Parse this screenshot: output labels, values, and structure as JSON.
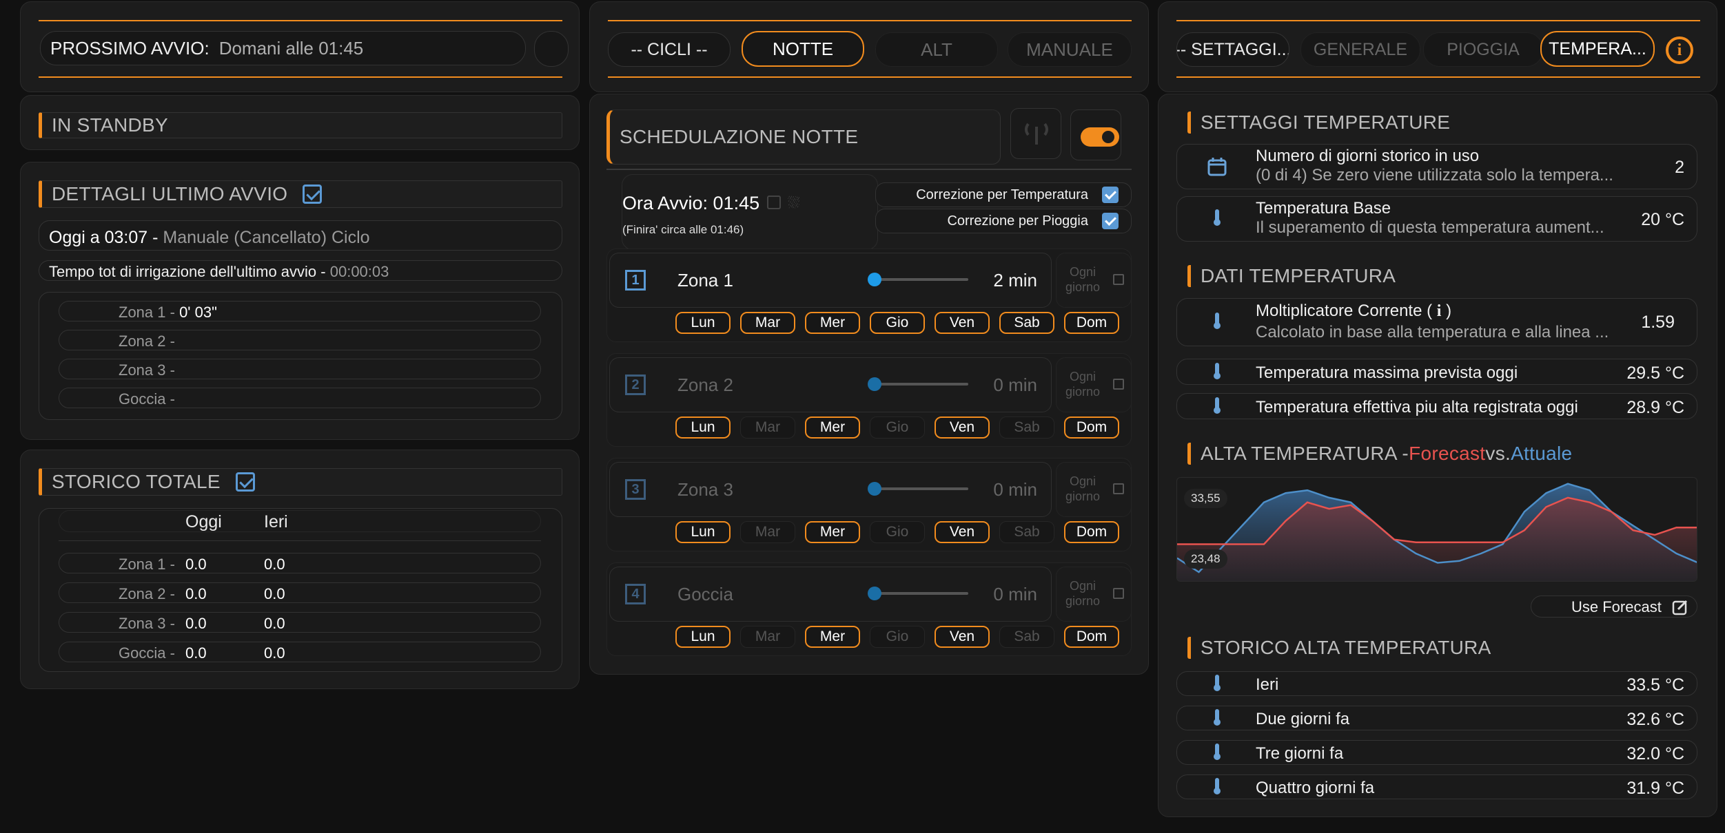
{
  "left": {
    "next_start_label": "PROSSIMO AVVIO:",
    "next_start_value": "Domani alle 01:45",
    "standby": "IN STANDBY",
    "last_details_title": "DETTAGLI ULTIMO AVVIO",
    "last_when": "Oggi a 03:07 -",
    "last_what": "Manuale (Cancellato) Ciclo",
    "total_time_label": "Tempo tot di irrigazione dell'ultimo avvio -",
    "total_time_value": "00:00:03",
    "zones": [
      {
        "label": "Zona 1 -",
        "value": "0' 03\""
      },
      {
        "label": "Zona 2 -",
        "value": ""
      },
      {
        "label": "Zona 3 -",
        "value": ""
      },
      {
        "label": "Goccia -",
        "value": ""
      }
    ],
    "history_title": "STORICO TOTALE",
    "history_col_today": "Oggi",
    "history_col_yesterday": "Ieri",
    "history": [
      {
        "label": "Zona 1 -",
        "today": "0.0",
        "yesterday": "0.0"
      },
      {
        "label": "Zona 2 -",
        "today": "0.0",
        "yesterday": "0.0"
      },
      {
        "label": "Zona 3 -",
        "today": "0.0",
        "yesterday": "0.0"
      },
      {
        "label": "Goccia -",
        "today": "0.0",
        "yesterday": "0.0"
      }
    ]
  },
  "middle": {
    "tabs": [
      "-- CICLI --",
      "NOTTE",
      "ALT",
      "MANUALE"
    ],
    "active_tab": "NOTTE",
    "schedule_title": "SCHEDULAZIONE NOTTE",
    "start_time": "Ora Avvio: 01:45",
    "finish_note": "(Finira' circa alle 01:46)",
    "temp_correction": "Correzione per Temperatura",
    "rain_correction": "Correzione per Pioggia",
    "every_day": "Ogni giorno",
    "days": [
      "Lun",
      "Mar",
      "Mer",
      "Gio",
      "Ven",
      "Sab",
      "Dom"
    ],
    "zones": [
      {
        "num": "1",
        "name": "Zona 1",
        "duration": "2 min",
        "active": true,
        "slider": 0,
        "days_on": [
          true,
          true,
          true,
          true,
          true,
          true,
          true
        ]
      },
      {
        "num": "2",
        "name": "Zona 2",
        "duration": "0 min",
        "active": false,
        "slider": 0,
        "days_on": [
          true,
          false,
          true,
          false,
          true,
          false,
          true
        ]
      },
      {
        "num": "3",
        "name": "Zona 3",
        "duration": "0 min",
        "active": false,
        "slider": 0,
        "days_on": [
          true,
          false,
          true,
          false,
          true,
          false,
          true
        ]
      },
      {
        "num": "4",
        "name": "Goccia",
        "duration": "0 min",
        "active": false,
        "slider": 0,
        "days_on": [
          true,
          false,
          true,
          false,
          true,
          false,
          true
        ]
      }
    ]
  },
  "right": {
    "tabs": [
      "-- SETTAGGI...",
      "GENERALE",
      "PIOGGIA",
      "TEMPERA..."
    ],
    "active_tab": "TEMPERA...",
    "settings_title": "SETTAGGI TEMPERATURE",
    "history_days_label": "Numero di giorni storico in uso",
    "history_days_sub": "(0 di 4) Se zero viene utilizzata solo la tempera...",
    "history_days_value": "2",
    "base_temp_label": "Temperatura Base",
    "base_temp_sub": "Il superamento di questa temperatura aument...",
    "base_temp_value": "20 °C",
    "data_title": "DATI TEMPERATURA",
    "multiplier_label": "Moltiplicatore Corrente (",
    "multiplier_info": "i",
    "multiplier_close": ")",
    "multiplier_sub": "Calcolato in base alla temperatura e alla linea ...",
    "multiplier_value": "1.59",
    "max_forecast_label": "Temperatura massima prevista oggi",
    "max_forecast_value": "29.5 °C",
    "max_actual_label": "Temperatura effettiva piu alta registrata oggi",
    "max_actual_value": "28.9 °C",
    "chart_title_a": "ALTA TEMPERATURA - ",
    "chart_title_forecast": "Forecast",
    "chart_title_vs": " vs. ",
    "chart_title_actual": "Attuale",
    "use_forecast": "Use Forecast",
    "history_title": "STORICO ALTA TEMPERATURA",
    "history": [
      {
        "label": "Ieri",
        "value": "33.5 °C"
      },
      {
        "label": "Due giorni fa",
        "value": "32.6 °C"
      },
      {
        "label": "Tre giorni fa",
        "value": "32.0 °C"
      },
      {
        "label": "Quattro giorni fa",
        "value": "31.9 °C"
      }
    ]
  },
  "colors": {
    "accent": "#f28c1e",
    "forecast": "#e8534f",
    "actual": "#4d8fc9",
    "slider": "#1e9be8"
  },
  "chart_data": {
    "type": "line",
    "ylim": [
      23.48,
      33.55
    ],
    "tick_labels": [
      "33,55",
      "23,48"
    ],
    "series": [
      {
        "name": "Forecast",
        "values": [
          27.0,
          27.0,
          27.0,
          27.0,
          27.0,
          29.5,
          31.5,
          30.8,
          31.2,
          29.5,
          27.5,
          27.2,
          27.2,
          27.2,
          27.2,
          27.2,
          28.5,
          31.0,
          32.0,
          31.5,
          30.5,
          28.5,
          28.0,
          28.8,
          28.8
        ]
      },
      {
        "name": "Attuale",
        "values": [
          25.5,
          24.0,
          26.5,
          29.0,
          31.5,
          32.5,
          32.8,
          32.0,
          31.5,
          29.5,
          27.5,
          26.0,
          25.0,
          25.2,
          26.0,
          27.0,
          30.5,
          32.5,
          33.5,
          32.8,
          30.5,
          29.0,
          27.5,
          26.0,
          25.0
        ]
      }
    ]
  }
}
